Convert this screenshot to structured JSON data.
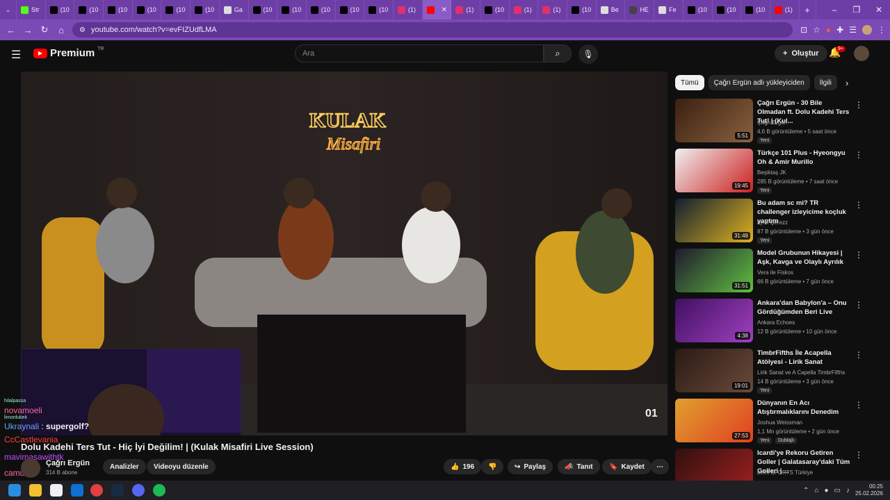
{
  "tabs": [
    {
      "label": "Str",
      "color": "#53fc18"
    },
    {
      "label": "(10",
      "color": "#000000"
    },
    {
      "label": "(10",
      "color": "#000000"
    },
    {
      "label": "(10",
      "color": "#000000"
    },
    {
      "label": "(10",
      "color": "#000000"
    },
    {
      "label": "(10",
      "color": "#000000"
    },
    {
      "label": "(10",
      "color": "#000000"
    },
    {
      "label": "Ga",
      "color": "#dddddd"
    },
    {
      "label": "(10",
      "color": "#000000"
    },
    {
      "label": "(10",
      "color": "#000000"
    },
    {
      "label": "(10",
      "color": "#000000"
    },
    {
      "label": "(10",
      "color": "#000000"
    },
    {
      "label": "(10",
      "color": "#000000"
    },
    {
      "label": "(1)",
      "color": "#e1306c"
    },
    {
      "label": "",
      "color": "#ff0000",
      "active": true
    },
    {
      "label": "(1)",
      "color": "#e1306c"
    },
    {
      "label": "(10",
      "color": "#000000"
    },
    {
      "label": "(1)",
      "color": "#e1306c"
    },
    {
      "label": "(1)",
      "color": "#e1306c"
    },
    {
      "label": "(10",
      "color": "#000000"
    },
    {
      "label": "Be",
      "color": "#dddddd"
    },
    {
      "label": "HE",
      "color": "#444444"
    },
    {
      "label": "Fe",
      "color": "#dddddd"
    },
    {
      "label": "(10",
      "color": "#000000"
    },
    {
      "label": "(10",
      "color": "#000000"
    },
    {
      "label": "(10",
      "color": "#000000"
    },
    {
      "label": "(1)",
      "color": "#ff0000"
    }
  ],
  "address": {
    "url": "youtube.com/watch?v=evFIZUdfLMA"
  },
  "yt": {
    "logo": "Premium",
    "logo_sup": "TR",
    "search_placeholder": "Ara",
    "create": "Oluştur",
    "bell_badge": "9+"
  },
  "video": {
    "title": "Dolu Kadehi Ters Tut - Hiç İyi Değilim! | (Kulak Misafiri Live Session)",
    "channel": "Çağrı Ergün",
    "subs": "314 B abone",
    "likes": "196",
    "badge": "01",
    "buttons": {
      "analytics": "Analizler",
      "edit": "Videoyu düzenle",
      "share": "Paylaş",
      "promote": "Tanıt",
      "save": "Kaydet"
    }
  },
  "chat": [
    {
      "user": "hilalpassa",
      "text": "",
      "small": true
    },
    {
      "user": "novamoeli",
      "text": "",
      "color": "#ff6b9a"
    },
    {
      "user": "limonlukek",
      "text": "",
      "small": true
    },
    {
      "user": "Ukraynali",
      "text": "supergolf?",
      "color": "#6aa6ff"
    },
    {
      "user": "CcCastlevania",
      "text": "",
      "color": "#ff4040"
    },
    {
      "user": "mavimasawithtk",
      "text": "",
      "color": "#c050ff"
    },
    {
      "user": "camuka",
      "text": "",
      "color": "#ff6b9a"
    }
  ],
  "chips": [
    "Tümü",
    "Çağrı Ergün adlı yükleyiciden",
    "İlgili"
  ],
  "recommendations": [
    {
      "title": "Çağrı Ergün - 30 Bile Olmadan ft. Dolu Kadehi Ters Tut! | (Kul...",
      "channel": "Çağrı Ergün",
      "meta": "4,6 B görüntüleme • 5 saat önce",
      "tag": "Yeni",
      "duration": "5:51",
      "c1": "#3a2010",
      "c2": "#8a6040"
    },
    {
      "title": "Türkçe 101 Plus - Hyeongyu Oh & Amir Murillo",
      "channel": "Beşiktaş JK",
      "meta": "285 B görüntüleme • 7 saat önce",
      "tag": "Yeni",
      "duration": "19:45",
      "c1": "#f0f0f0",
      "c2": "#cc2020"
    },
    {
      "title": "Bu adam sc mi? TR challenger izleyicime koçluk yaptım",
      "channel": "Lynx Çerezz",
      "meta": "87 B görüntüleme • 3 gün önce",
      "tag": "Yeni",
      "duration": "31:49",
      "c1": "#102030",
      "c2": "#e0b020"
    },
    {
      "title": "Model Grubunun Hikayesi | Aşk, Kavga ve Olaylı Ayrılık",
      "channel": "Vera ile Fiskos",
      "meta": "66 B görüntüleme • 7 gün önce",
      "tag": "",
      "duration": "31:51",
      "c1": "#201830",
      "c2": "#60c040"
    },
    {
      "title": "Ankara'dan Babylon'a – Onu Gördüğümden Beri Live",
      "channel": "Ankara Echoes",
      "meta": "12 B görüntüleme • 10 gün önce",
      "tag": "",
      "duration": "4:38",
      "c1": "#401060",
      "c2": "#a040c0"
    },
    {
      "title": "TimbrFifths İle Acapella Atölyesi - Lirik Sanat",
      "channel": "Lirik Sanat ve A Capella TimbrFifths",
      "meta": "14 B görüntüleme • 3 gün önce",
      "tag": "Yeni",
      "duration": "19:01",
      "c1": "#2a1a14",
      "c2": "#6a4a3a"
    },
    {
      "title": "Dünyanın En Acı Atıştırmalıklarını Denedim",
      "channel": "Joshua Weissman",
      "meta": "1,1 Mn görüntüleme • 2 gün önce",
      "tag": "Yeni",
      "tag2": "Dublajlı",
      "duration": "27:53",
      "c1": "#e0a030",
      "c2": "#e04020"
    },
    {
      "title": "Icardi'ye Rekoru Getiren Goller | Galatasaray'daki Tüm Golleri | ...",
      "channel": "beIN SPORTS Türkiye",
      "meta": "",
      "tag": "",
      "duration": "",
      "c1": "#301010",
      "c2": "#a02020"
    }
  ],
  "taskbar": {
    "time": "00:25",
    "date": "25.02.2026"
  }
}
